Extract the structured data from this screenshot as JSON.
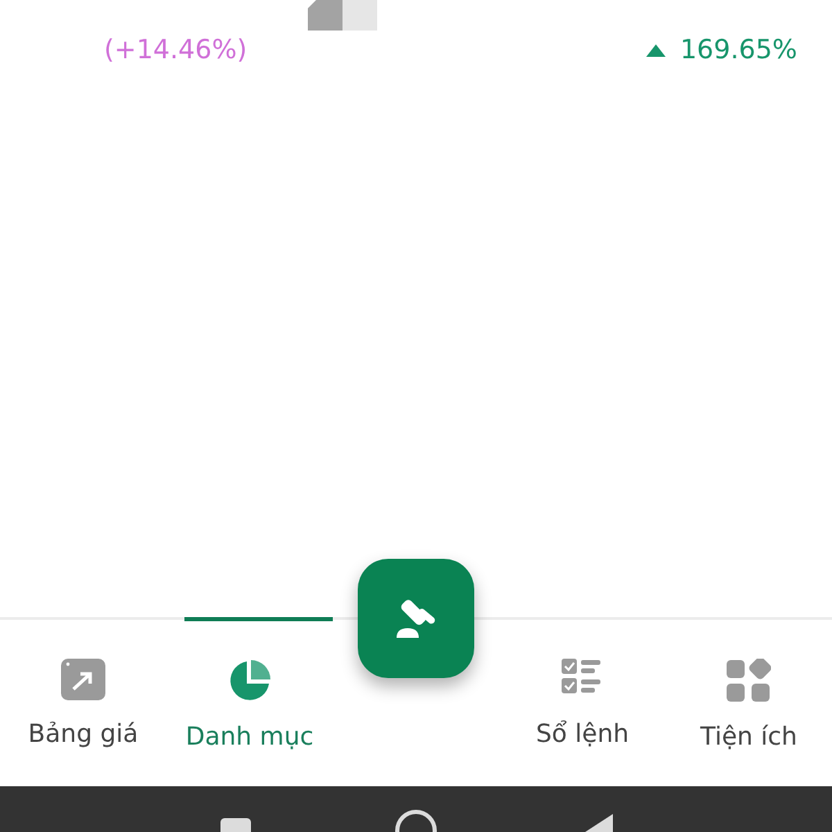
{
  "summary": {
    "change": "(+14.46%)",
    "total_return": "169.65%"
  },
  "nav": {
    "tabs": [
      {
        "label": "Bảng giá",
        "kind": "chart",
        "selected": false
      },
      {
        "label": "Danh mục",
        "kind": "pie",
        "selected": true
      },
      {
        "label": "Sổ lệnh",
        "kind": "list",
        "selected": false
      },
      {
        "label": "Tiện ích",
        "kind": "grid",
        "selected": false
      }
    ]
  }
}
